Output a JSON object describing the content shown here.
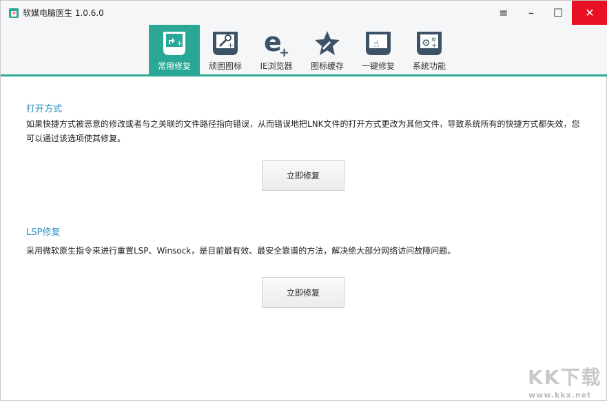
{
  "window": {
    "title": "软媒电脑医生 1.0.6.0",
    "menu_icon": "≡",
    "min_icon": "–",
    "max_icon": "☐",
    "close_icon": "✕"
  },
  "tabs": [
    {
      "label": "常用修复",
      "icon": "shortcut-fix-icon",
      "active": true
    },
    {
      "label": "顽固图标",
      "icon": "wrench-icon"
    },
    {
      "label": "IE浏览器",
      "icon": "ie-icon"
    },
    {
      "label": "图标缓存",
      "icon": "star-wrench-icon"
    },
    {
      "label": "一键修复",
      "icon": "hand-click-icon"
    },
    {
      "label": "系统功能",
      "icon": "gears-icon"
    }
  ],
  "sections": [
    {
      "title": "打开方式",
      "description": "如果快捷方式被恶意的修改或者与之关联的文件路径指向错误，从而错误地把LNK文件的打开方式更改为其他文件，导致系统所有的快捷方式都失效，您可以通过该选项使其修复。",
      "button": "立即修复"
    },
    {
      "title": "LSP修复",
      "description": "采用微软原生指令来进行重置LSP、Winsock，是目前最有效、最安全靠谱的方法，解决绝大部分网络访问故障问题。",
      "button": "立即修复"
    }
  ],
  "watermark": {
    "logo": "KK下载",
    "url": "www.kkx.net"
  },
  "colors": {
    "accent": "#2aa895",
    "icon": "#3d5266",
    "section_title": "#2a8fc0",
    "close": "#e81123"
  }
}
